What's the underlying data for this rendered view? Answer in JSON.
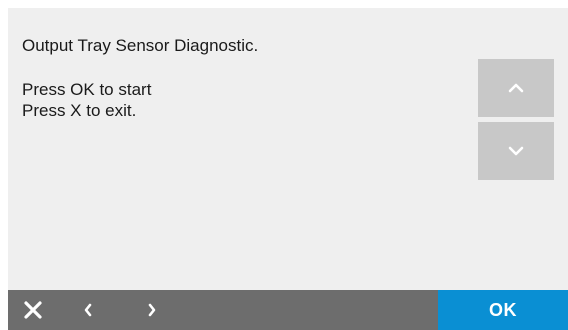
{
  "dialog": {
    "title": "Output Tray Sensor Diagnostic.",
    "lines": [
      "Press OK to start",
      "Press X to exit."
    ]
  },
  "scroll": {
    "up_icon": "chevron-up-icon",
    "down_icon": "chevron-down-icon"
  },
  "bottom_bar": {
    "close_icon": "close-icon",
    "back_icon": "chevron-left-icon",
    "forward_icon": "chevron-right-icon",
    "ok_label": "OK"
  },
  "colors": {
    "screen_bg": "#efefef",
    "scroll_button_bg": "#c8c8c8",
    "bottom_bar_bg": "#6d6d6d",
    "ok_button_bg": "#0a8fd3",
    "text": "#1a1a1a"
  }
}
